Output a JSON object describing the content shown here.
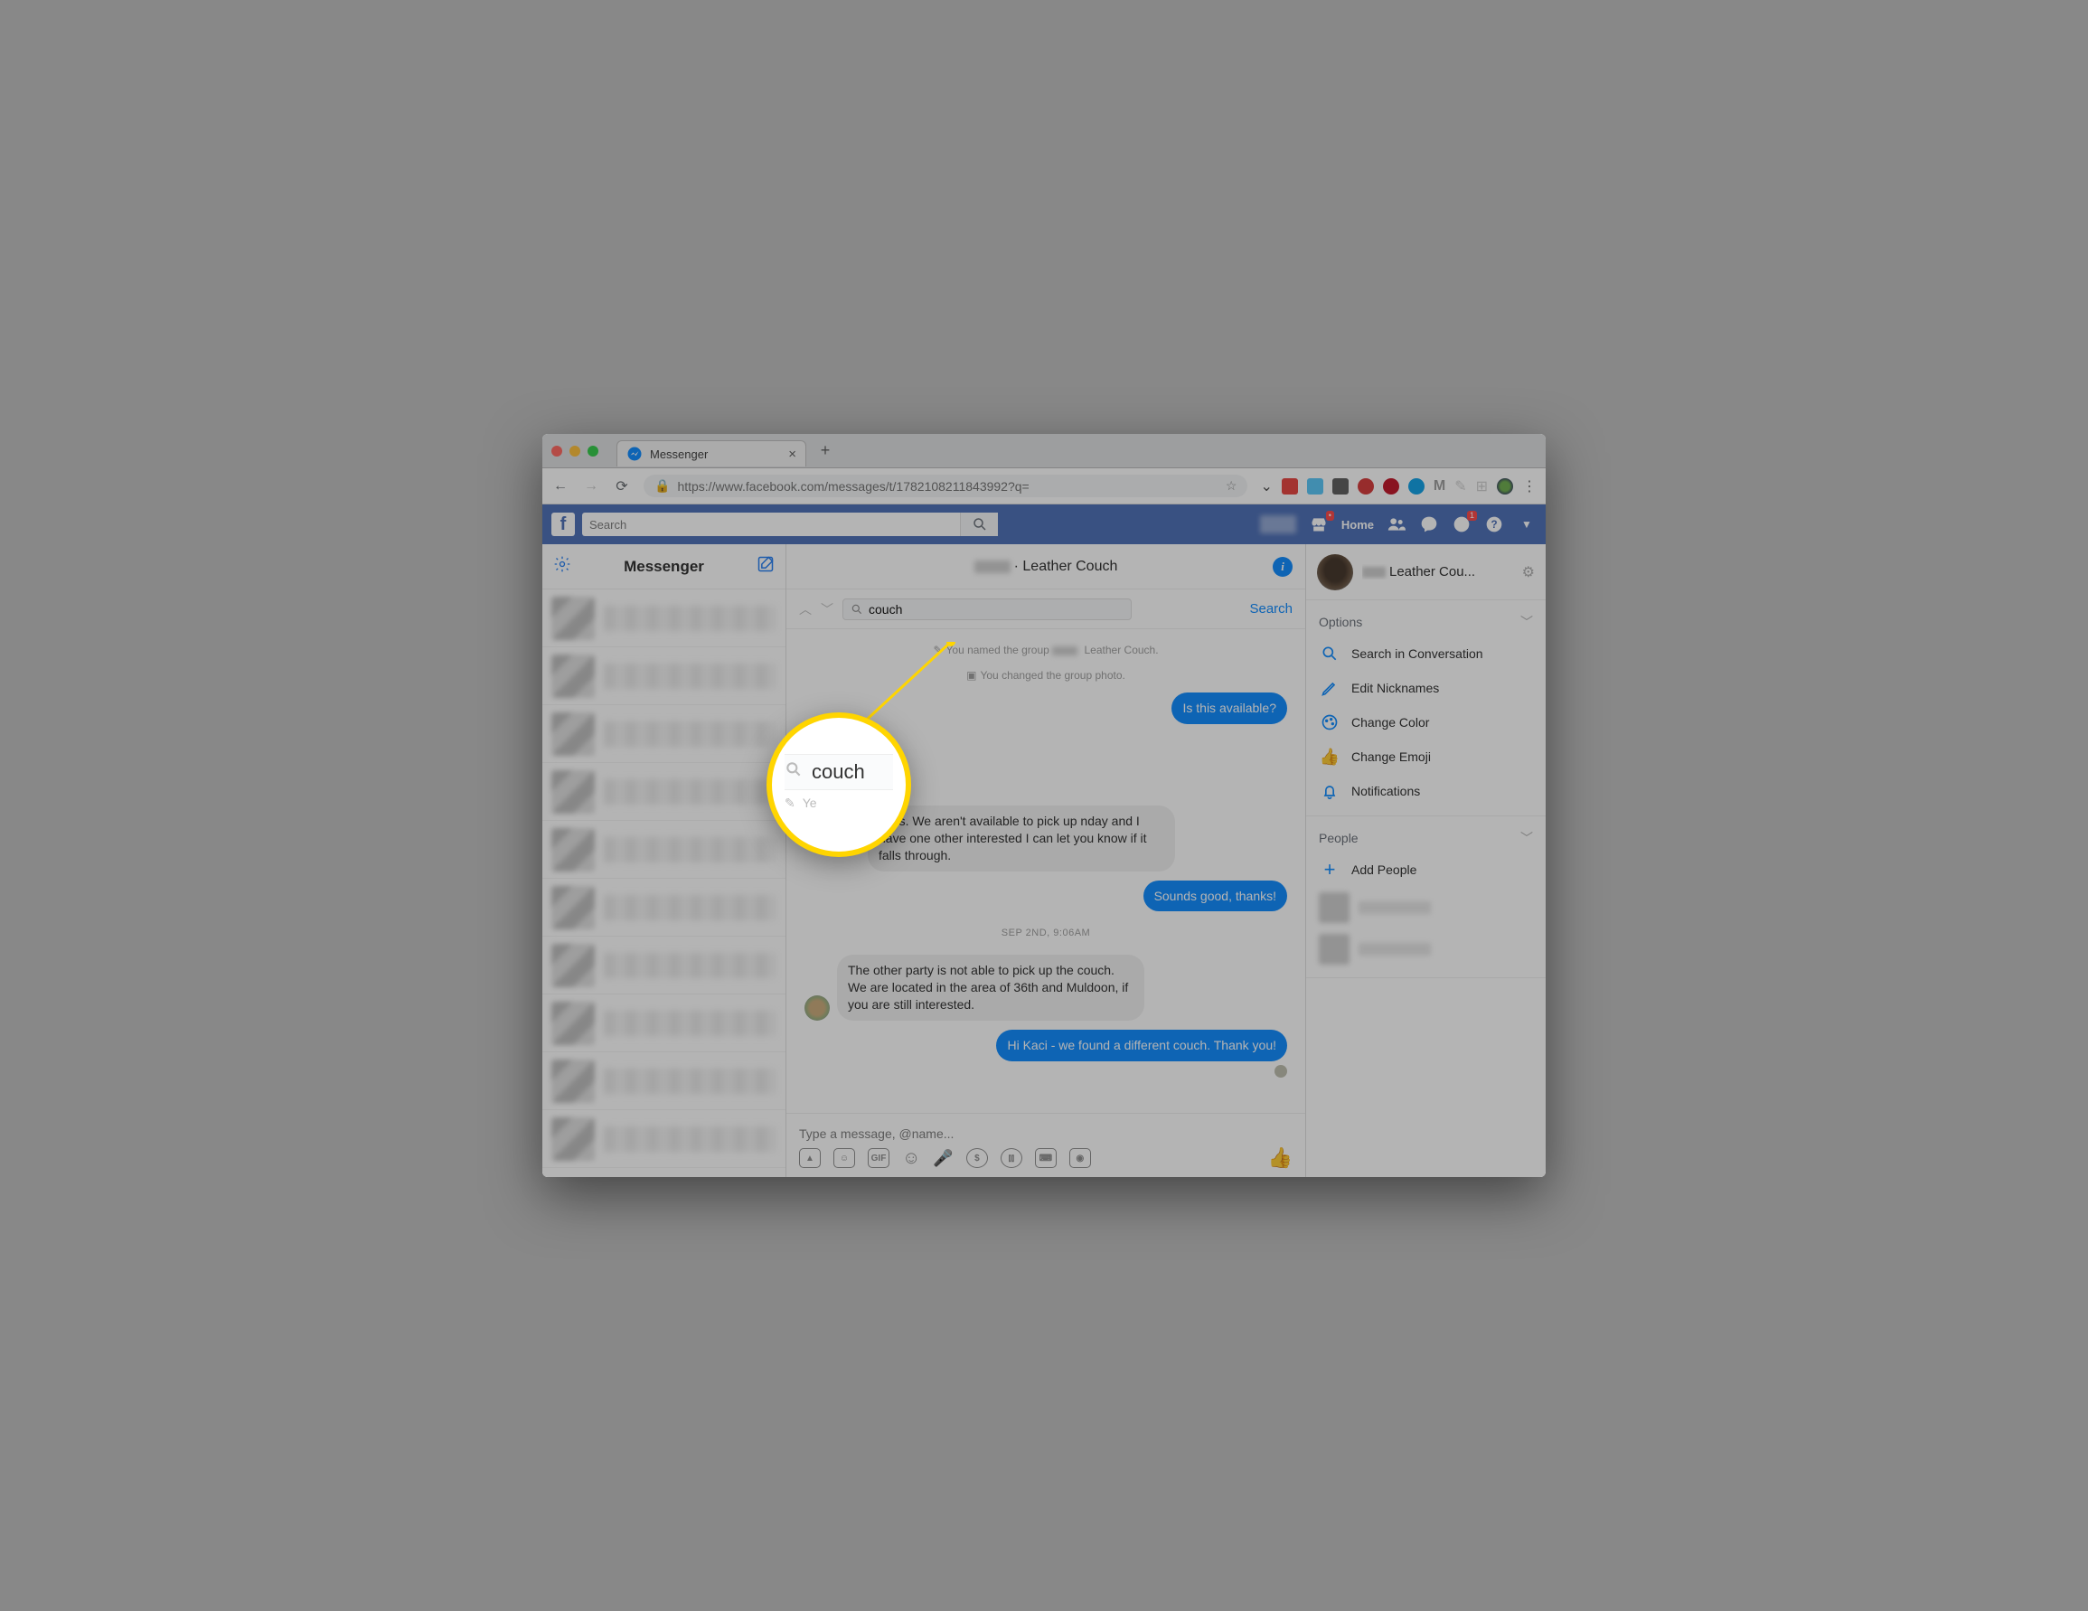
{
  "tab": {
    "title": "Messenger"
  },
  "url": "https://www.facebook.com/messages/t/1782108211843992?q=",
  "fb": {
    "search_placeholder": "Search",
    "home_label": "Home",
    "notif_badge": "1"
  },
  "left": {
    "title": "Messenger"
  },
  "chat": {
    "header_title": " · Leather Couch",
    "search_value": "couch",
    "search_link": "Search",
    "sys1_prefix": "You named the group ",
    "sys1_suffix": " Leather Couch.",
    "sys2": "You changed the group photo.",
    "m1": "Is this available?",
    "m2": ", yes.  We aren't available to pick up nday and I have one other interested I can let you know if it falls through.",
    "m3": "Sounds good, thanks!",
    "ts1": "SEP 2ND, 9:06AM",
    "m4": "The other party is not able to pick up the couch.  We are located in the area of 36th and Muldoon, if you are still interested.",
    "m5": "Hi Kaci - we found a different couch. Thank you!",
    "composer_placeholder": "Type a message, @name..."
  },
  "right": {
    "title": "Leather Cou...",
    "sec_options": "Options",
    "opt_search": "Search in Conversation",
    "opt_nick": "Edit Nicknames",
    "opt_color": "Change Color",
    "opt_emoji": "Change Emoji",
    "opt_notif": "Notifications",
    "sec_people": "People",
    "add_people": "Add People"
  },
  "callout": {
    "text": "couch",
    "below": "Ye"
  },
  "composer_icons": {
    "gif": "GIF"
  }
}
